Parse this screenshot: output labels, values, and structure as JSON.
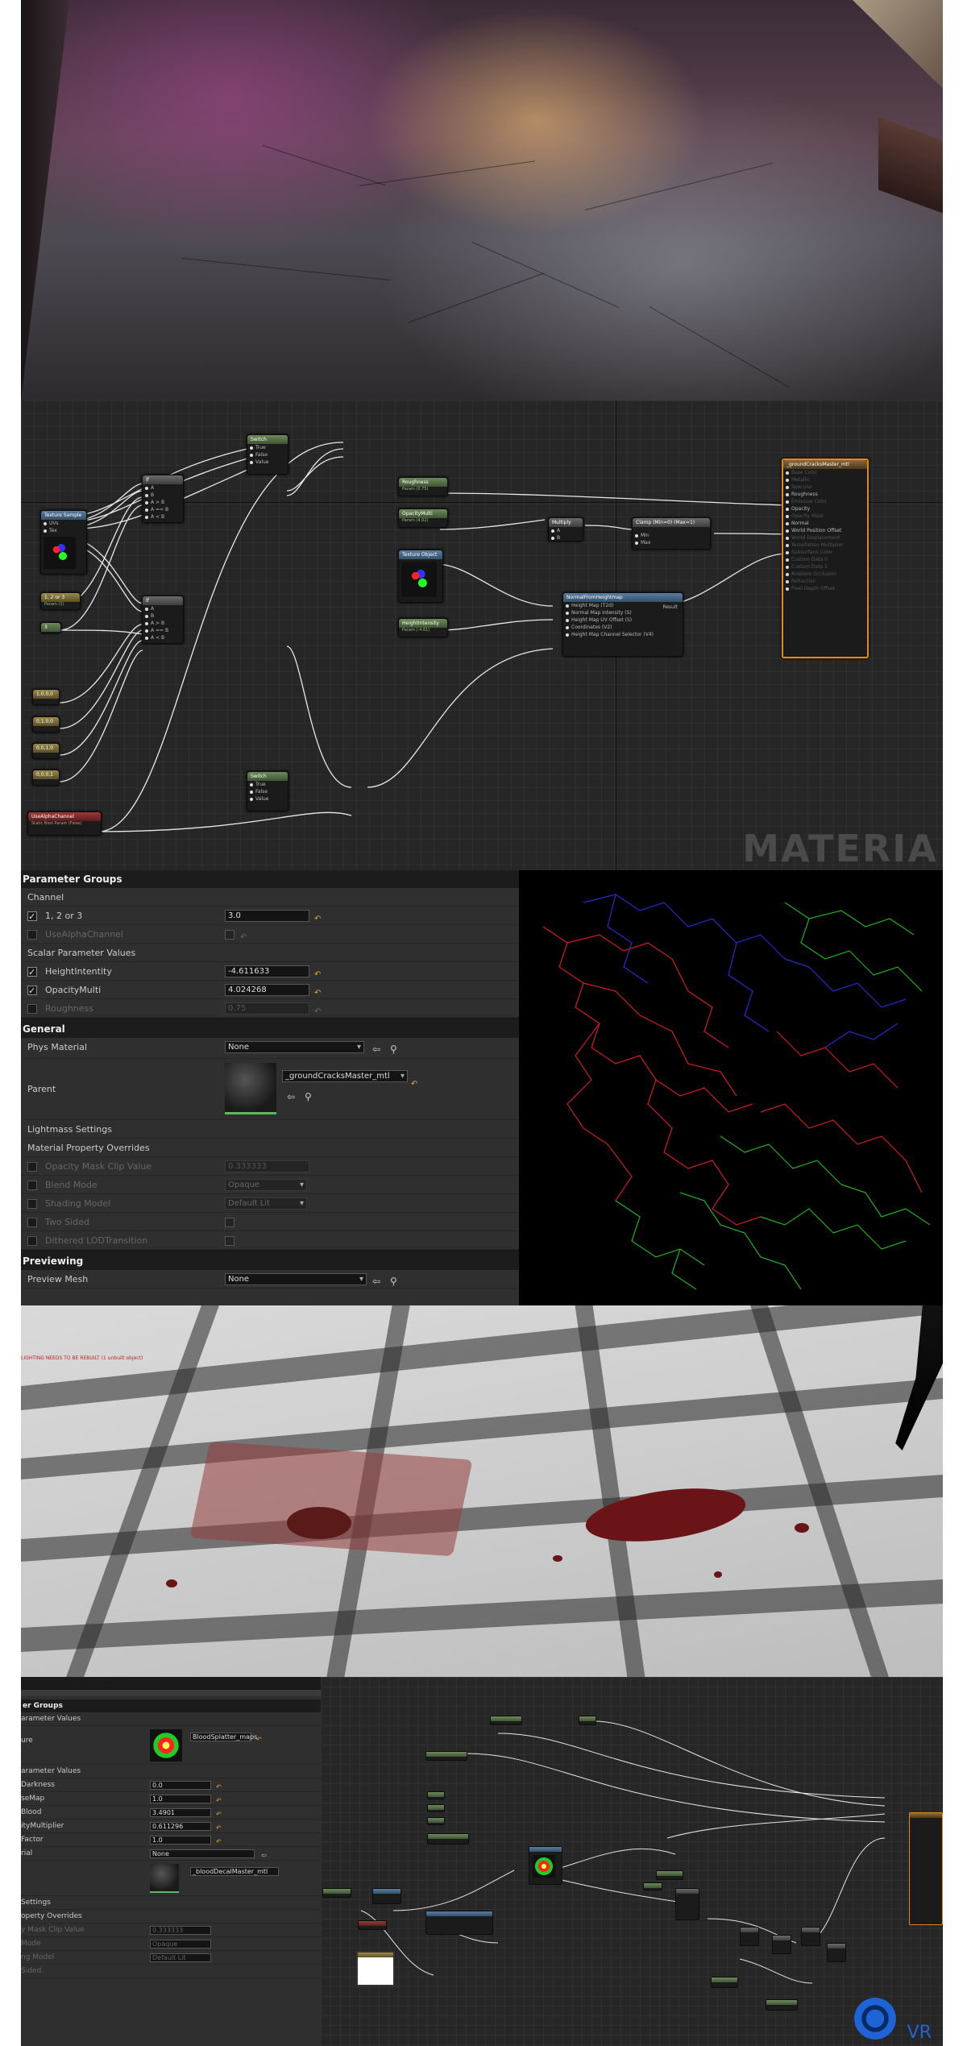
{
  "graph1": {
    "watermark": "MATERIA",
    "nodes": {
      "texture_sample": {
        "title": "Texture Sample",
        "pins": [
          "UVs",
          "Tex"
        ]
      },
      "switch_top": {
        "title": "Switch",
        "pins": [
          "True",
          "False",
          "Value"
        ]
      },
      "switch_bottom": {
        "title": "Switch",
        "pins": [
          "True",
          "False",
          "Value"
        ]
      },
      "if_top": {
        "title": "If",
        "pins": [
          "A",
          "B",
          "A > B",
          "A == B",
          "A < B"
        ]
      },
      "if_bottom": {
        "title": "If",
        "pins": [
          "A",
          "B",
          "A > B",
          "A == B",
          "A < B"
        ]
      },
      "channel_param": {
        "title": "1, 2 or 3",
        "sub": "Param (1)"
      },
      "const_3": {
        "title": "3"
      },
      "const_a": {
        "title": "1,0,0,0"
      },
      "const_b": {
        "title": "0,1,0,0"
      },
      "const_c": {
        "title": "0,0,1,0"
      },
      "const_d": {
        "title": "0,0,0,1"
      },
      "use_alpha": {
        "title": "UseAlphaChannel",
        "sub": "Static Bool Param (False)"
      },
      "roughness": {
        "title": "Roughness",
        "sub": "Param (0.75)"
      },
      "opacity_multi": {
        "title": "OpacityMulti",
        "sub": "Param (4.02)"
      },
      "texture_object": {
        "title": "Texture Object"
      },
      "height_intensity": {
        "title": "HeightIntensity",
        "sub": "Param (-4.61)"
      },
      "multiply": {
        "title": "Multiply",
        "pins": [
          "A",
          "B"
        ]
      },
      "clamp": {
        "title": "Clamp (Min=0) (Max=1)",
        "pins": [
          "Min",
          "Max"
        ]
      },
      "normal_from_heightmap": {
        "title": "NormalFromHeightmap",
        "pins": [
          "Height Map (T2d)",
          "Normal Map Intensity (S)",
          "Height Map UV Offset (S)",
          "Coordinates (V2)",
          "Height Map Channel Selector (V4)"
        ],
        "output": "Result"
      },
      "result": {
        "title": "_groundCracksMaster_mtl",
        "pins": [
          "Base Color",
          "Metallic",
          "Specular",
          "Roughness",
          "Emissive Color",
          "Opacity",
          "Opacity Mask",
          "Normal",
          "World Position Offset",
          "World Displacement",
          "Tessellation Multiplier",
          "Subsurface Color",
          "Custom Data 0",
          "Custom Data 1",
          "Ambient Occlusion",
          "Refraction",
          "Pixel Depth Offset"
        ]
      }
    }
  },
  "details1": {
    "parameter_groups": "Parameter Groups",
    "channel": "Channel",
    "channel_param_label": "1, 2 or 3",
    "channel_param_value": "3.0",
    "use_alpha_label": "UseAlphaChannel",
    "scalar_params": "Scalar Parameter Values",
    "height_label": "HeightIntentity",
    "height_value": "-4.611633",
    "opacity_label": "OpacityMulti",
    "opacity_value": "4.024268",
    "roughness_label": "Roughness",
    "roughness_value": "0.75",
    "general": "General",
    "phys_material_label": "Phys Material",
    "phys_material_value": "None",
    "parent_label": "Parent",
    "parent_value": "_groundCracksMaster_mtl",
    "lightmass": "Lightmass Settings",
    "overrides": "Material Property Overrides",
    "opacity_clip_label": "Opacity Mask Clip Value",
    "opacity_clip_value": "0.333333",
    "blend_label": "Blend Mode",
    "blend_value": "Opaque",
    "shading_label": "Shading Model",
    "shading_value": "Default Lit",
    "two_sided_label": "Two Sided",
    "dithered_label": "Dithered LODTransition",
    "previewing": "Previewing",
    "preview_mesh_label": "Preview Mesh",
    "preview_mesh_value": "None"
  },
  "blood_scene": {
    "overlay_text": "LIGHTING NEEDS TO BE REBUILT (1 unbuilt object)"
  },
  "details2": {
    "groups": "er Groups",
    "tex_params": "arameter Values",
    "tex_label": "ure",
    "tex_value": "BloodSplatter_maps",
    "scalar_params": "arameter Values",
    "p1_label": "Darkness",
    "p1_value": "0.0",
    "p2_label": "seMap",
    "p2_value": "1.0",
    "p3_label": "Blood",
    "p3_value": "3.4901",
    "p4_label": "ityMultiplier",
    "p4_value": "0.611296",
    "p5_label": "Factor",
    "p5_value": "1.0",
    "phys_label": "rial",
    "phys_value": "None",
    "parent_value": "_bloodDecalMaster_mtl",
    "lightmass": "Settings",
    "overrides": "operty Overrides",
    "clip_label": "y Mask Clip Value",
    "clip_value": "0.333333",
    "blend_label": "Mode",
    "blend_value": "Opaque",
    "shading_label": "ng Model",
    "shading_value": "Default Lit",
    "sided_label": "Sided"
  },
  "graph2": {
    "logo_text": "VR"
  },
  "colors": {
    "accent_orange": "#e08a1a",
    "node_green": "#6d8a5a",
    "reset_yellow": "#e0a62c",
    "logo_blue": "#1e64d6"
  }
}
